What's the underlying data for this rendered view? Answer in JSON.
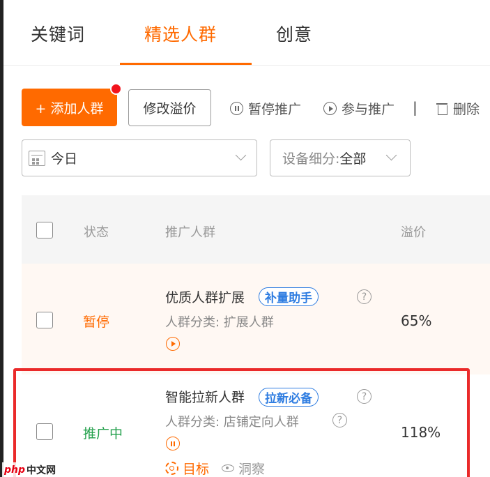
{
  "tabs": [
    {
      "label": "关键词",
      "active": false
    },
    {
      "label": "精选人群",
      "active": true
    },
    {
      "label": "创意",
      "active": false
    }
  ],
  "toolbar": {
    "add_label": "+ 添加人群",
    "edit_premium_label": "修改溢价",
    "pause_label": "暂停推广",
    "join_label": "参与推广",
    "separator": "|",
    "delete_label": "删除"
  },
  "filters": {
    "date_value": "今日",
    "device_label": "设备细分:",
    "device_value": "全部"
  },
  "table": {
    "columns": [
      "状态",
      "推广人群",
      "溢价"
    ],
    "rows": [
      {
        "status": "暂停",
        "status_color": "#ff6a00",
        "name": "优质人群扩展",
        "tag": "补量助手",
        "category": "人群分类:  扩展人群",
        "premium": "65%"
      },
      {
        "status": "推广中",
        "status_color": "#22a04b",
        "name": "智能拉新人群",
        "tag": "拉新必备",
        "category": "人群分类:  店铺定向人群",
        "premium": "118%",
        "actions": [
          "目标",
          "洞察"
        ]
      }
    ]
  },
  "watermark": {
    "mark": "php",
    "text": "中文网"
  },
  "colors": {
    "accent": "#ff6a00",
    "tag_blue": "#2f7de1",
    "active_green": "#22a04b",
    "highlight_red": "#ea2a2a"
  }
}
